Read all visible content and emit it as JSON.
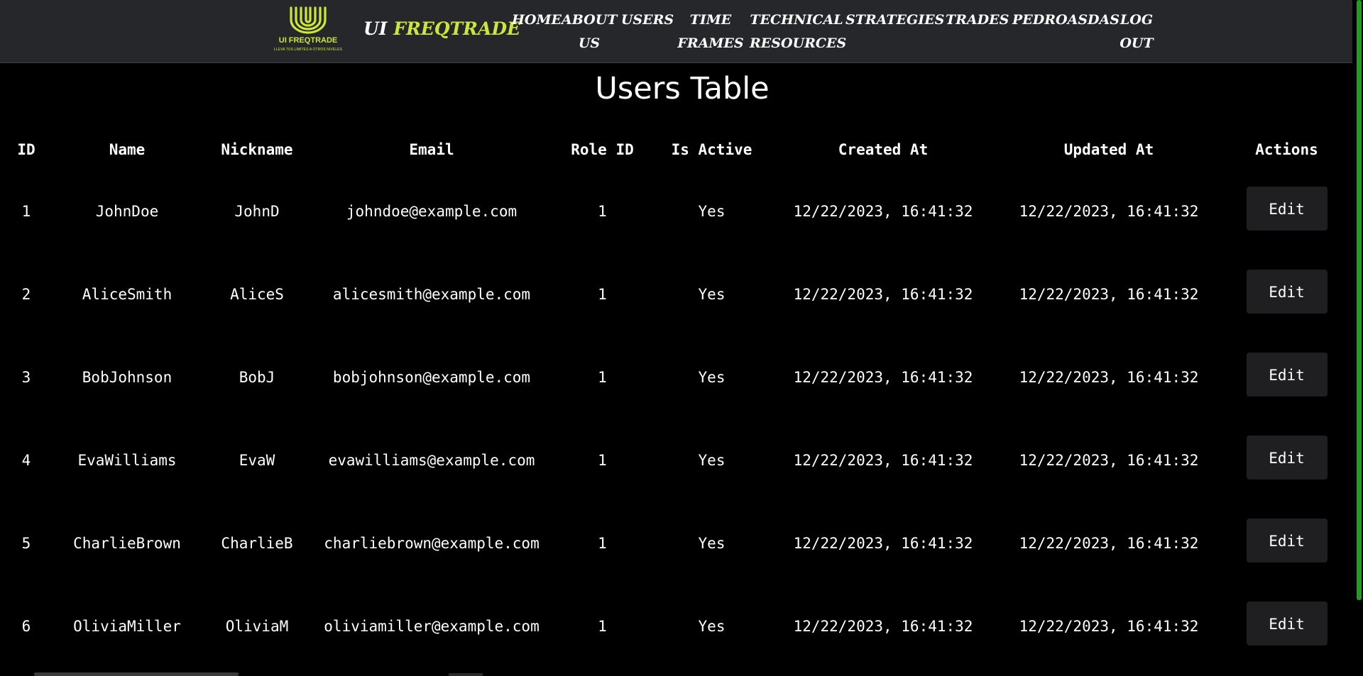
{
  "brand": {
    "logo_text": "UI FREQTRADE",
    "logo_tagline": "LLEVA TUS LIMITES A OTROS NIVELES",
    "name_prefix": "UI",
    "name_suffix": "FREQTRADE",
    "accent_color": "#cde63a"
  },
  "nav": {
    "items": [
      {
        "label": "HOME"
      },
      {
        "label": "ABOUT\nUS"
      },
      {
        "label": "USERS"
      },
      {
        "label": "TIME\nFRAMES"
      },
      {
        "label": "TECHNICAL\nRESOURCES"
      },
      {
        "label": "STRATEGIES"
      },
      {
        "label": "TRADES"
      },
      {
        "label": "PEDROASDAS"
      },
      {
        "label": "LOG\nOUT"
      }
    ]
  },
  "main": {
    "title": "Users Table",
    "table": {
      "columns": [
        "ID",
        "Name",
        "Nickname",
        "Email",
        "Role ID",
        "Is Active",
        "Created At",
        "Updated At",
        "Actions"
      ],
      "rows": [
        {
          "id": "1",
          "name": "JohnDoe",
          "nickname": "JohnD",
          "email": "johndoe@example.com",
          "role_id": "1",
          "is_active": "Yes",
          "created_at": "12/22/2023, 16:41:32",
          "updated_at": "12/22/2023, 16:41:32",
          "action": "Edit"
        },
        {
          "id": "2",
          "name": "AliceSmith",
          "nickname": "AliceS",
          "email": "alicesmith@example.com",
          "role_id": "1",
          "is_active": "Yes",
          "created_at": "12/22/2023, 16:41:32",
          "updated_at": "12/22/2023, 16:41:32",
          "action": "Edit"
        },
        {
          "id": "3",
          "name": "BobJohnson",
          "nickname": "BobJ",
          "email": "bobjohnson@example.com",
          "role_id": "1",
          "is_active": "Yes",
          "created_at": "12/22/2023, 16:41:32",
          "updated_at": "12/22/2023, 16:41:32",
          "action": "Edit"
        },
        {
          "id": "4",
          "name": "EvaWilliams",
          "nickname": "EvaW",
          "email": "evawilliams@example.com",
          "role_id": "1",
          "is_active": "Yes",
          "created_at": "12/22/2023, 16:41:32",
          "updated_at": "12/22/2023, 16:41:32",
          "action": "Edit"
        },
        {
          "id": "5",
          "name": "CharlieBrown",
          "nickname": "CharlieB",
          "email": "charliebrown@example.com",
          "role_id": "1",
          "is_active": "Yes",
          "created_at": "12/22/2023, 16:41:32",
          "updated_at": "12/22/2023, 16:41:32",
          "action": "Edit"
        },
        {
          "id": "6",
          "name": "OliviaMiller",
          "nickname": "OliviaM",
          "email": "oliviamiller@example.com",
          "role_id": "1",
          "is_active": "Yes",
          "created_at": "12/22/2023, 16:41:32",
          "updated_at": "12/22/2023, 16:41:32",
          "action": "Edit"
        }
      ]
    }
  },
  "colors": {
    "background": "#000000",
    "navbar": "#25272a",
    "button": "#1f1f21",
    "scrollbar": "#1f9e22"
  }
}
